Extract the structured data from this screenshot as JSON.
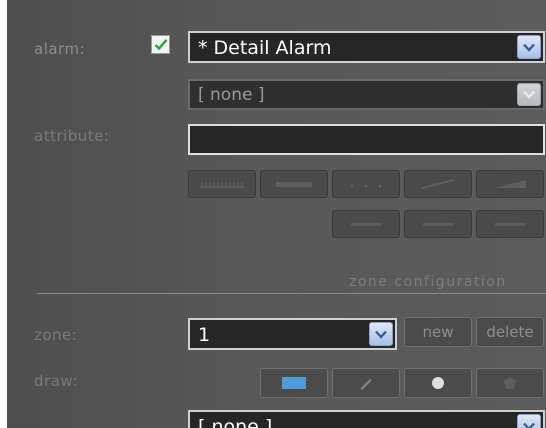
{
  "alarm": {
    "label": "alarm:",
    "enabled": true,
    "selected": "* Detail Alarm",
    "secondary_selected": "[ none ]"
  },
  "attribute": {
    "label": "attribute:",
    "value": ""
  },
  "toolbar_row1": [
    {
      "id": "btn-r1-1",
      "label": "",
      "icon": "ruler-icon"
    },
    {
      "id": "btn-r1-2",
      "label": "",
      "icon": "bar-icon"
    },
    {
      "id": "btn-r1-3",
      "label": "",
      "icon": "dots-icon"
    },
    {
      "id": "btn-r1-4",
      "label": "",
      "icon": "pen-icon"
    },
    {
      "id": "btn-r1-5",
      "label": "",
      "icon": "wedge-icon"
    }
  ],
  "toolbar_row2": [
    {
      "id": "btn-r2-1",
      "label": "",
      "icon": "text-icon"
    },
    {
      "id": "btn-r2-2",
      "label": "",
      "icon": "text-icon"
    },
    {
      "id": "btn-r2-3",
      "label": "",
      "icon": "text-icon"
    }
  ],
  "zone_section": {
    "title": "zone configuration",
    "zone_label": "zone:",
    "zone_value": "1",
    "new_label": "new",
    "delete_label": "delete",
    "draw_label": "draw:",
    "draw_tools": [
      "rectangle-icon",
      "pencil-icon",
      "circle-icon",
      "polygon-icon"
    ],
    "bottom_select": "[ none ]"
  },
  "colors": {
    "panel": "#585858",
    "field": "#262626",
    "check": "#2fa84a",
    "draw_rect": "#4f9ad8"
  }
}
